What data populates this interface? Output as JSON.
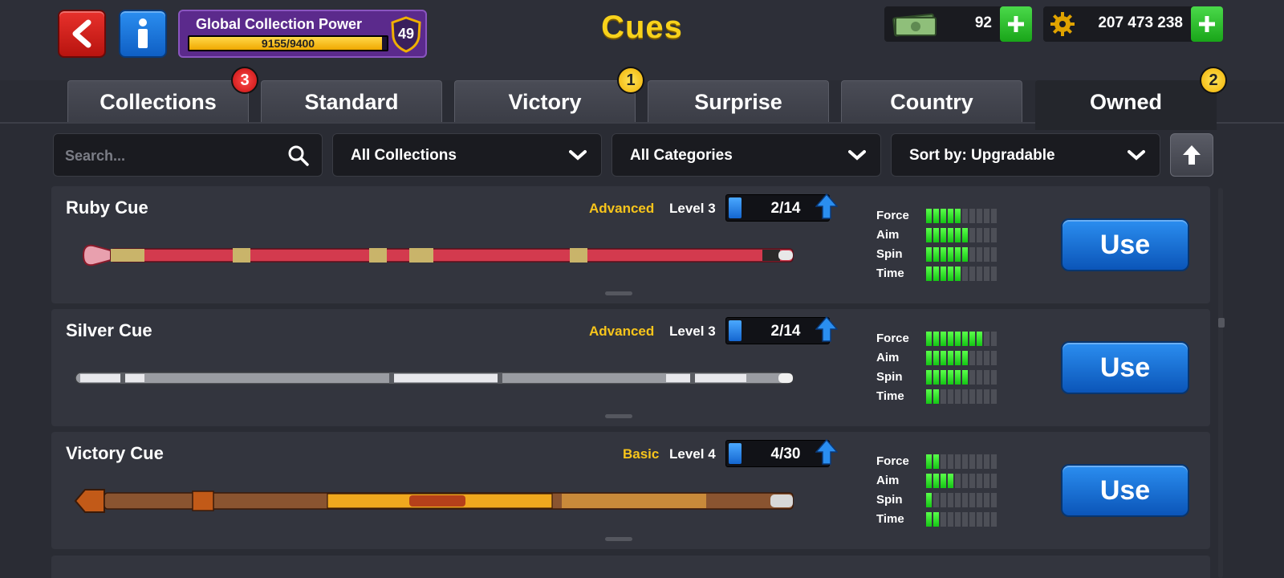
{
  "header": {
    "title": "Cues",
    "collection_power": {
      "label": "Global Collection Power",
      "value_text": "9155/9400",
      "progress": 0.974,
      "level": "49"
    },
    "cash": {
      "value": "92"
    },
    "coins": {
      "value": "207 473 238"
    }
  },
  "tabs": [
    {
      "label": "Collections",
      "badge": "3",
      "badge_color": "#d01818"
    },
    {
      "label": "Standard",
      "badge": null
    },
    {
      "label": "Victory",
      "badge": "1",
      "badge_color": "#f5c000"
    },
    {
      "label": "Surprise",
      "badge": null
    },
    {
      "label": "Country",
      "badge": null
    },
    {
      "label": "Owned",
      "badge": "2",
      "badge_color": "#f5c000",
      "active": true
    }
  ],
  "filters": {
    "search_placeholder": "Search...",
    "collections": "All Collections",
    "categories": "All Categories",
    "sort": "Sort by: Upgradable"
  },
  "stat_labels": {
    "force": "Force",
    "aim": "Aim",
    "spin": "Spin",
    "time": "Time"
  },
  "cues": [
    {
      "name": "Ruby Cue",
      "rarity": "Advanced",
      "level": "Level 3",
      "pieces": "2/14",
      "stats": {
        "force": 5,
        "aim": 6,
        "spin": 6,
        "time": 5
      },
      "use_label": "Use",
      "colors": {
        "main": "#d33a4e",
        "accent": "#e8a0ae",
        "band": "#c9b46a"
      }
    },
    {
      "name": "Silver Cue",
      "rarity": "Advanced",
      "level": "Level 3",
      "pieces": "2/14",
      "stats": {
        "force": 8,
        "aim": 6,
        "spin": 6,
        "time": 2
      },
      "use_label": "Use",
      "colors": {
        "main": "#9a9ca2",
        "accent": "#e8e8ec",
        "band": "#5a5c62"
      }
    },
    {
      "name": "Victory Cue",
      "rarity": "Basic",
      "level": "Level 4",
      "pieces": "4/30",
      "stats": {
        "force": 2,
        "aim": 4,
        "spin": 1,
        "time": 2
      },
      "use_label": "Use",
      "colors": {
        "main": "#8a5430",
        "accent": "#f0a81e",
        "band": "#c25a18"
      }
    }
  ],
  "colors": {
    "accent_title": "#f8d21b",
    "rarity": "#f8c51b",
    "use_button": "#1466d0"
  }
}
